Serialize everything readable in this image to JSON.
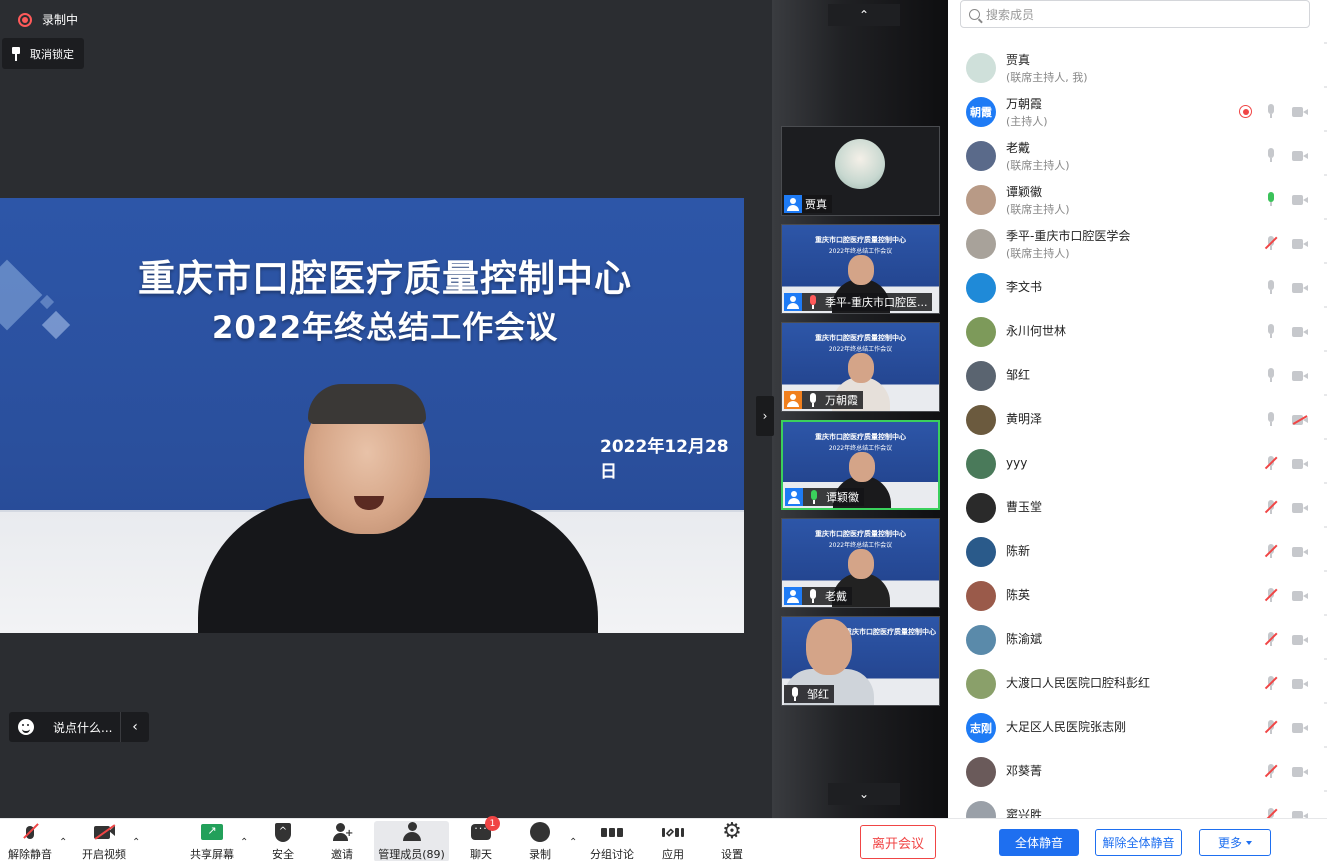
{
  "recording": {
    "label": "录制中",
    "color": "#ff5a5a"
  },
  "pin": {
    "label": "取消锁定"
  },
  "slide": {
    "title": "重庆市口腔医疗质量控制中心",
    "subtitle": "2022年终总结工作会议",
    "date": "2022年12月28日"
  },
  "chat_bar": {
    "placeholder": "说点什么..."
  },
  "gallery": {
    "mini_title": "重庆市口腔医疗质量控制中心",
    "mini_subtitle": "2022年终总结工作会议",
    "tiles": [
      {
        "name": "贾真"
      },
      {
        "name": "季平-重庆市口腔医..."
      },
      {
        "name": "万朝霞"
      },
      {
        "name": "谭颖徽"
      },
      {
        "name": "老戴"
      },
      {
        "name": "邹红"
      }
    ]
  },
  "search": {
    "placeholder": "搜索成员"
  },
  "members": [
    {
      "name": "贾真",
      "role": "(联席主持人, 我)",
      "avatar_color": "#cfe0da"
    },
    {
      "name": "万朝霞",
      "role": "(主持人)",
      "avatar_text": "朝霞",
      "avatar_color": "#1e7bf5"
    },
    {
      "name": "老戴",
      "role": "(联席主持人)",
      "avatar_color": "#5a6a8a"
    },
    {
      "name": "谭颖徽",
      "role": "(联席主持人)",
      "avatar_color": "#b89a86"
    },
    {
      "name": "季平-重庆市口腔医学会",
      "role": "(联席主持人)",
      "avatar_color": "#a8a29a"
    },
    {
      "name": "李文书",
      "role": "",
      "avatar_color": "#1f8ad8"
    },
    {
      "name": "永川何世林",
      "role": "",
      "avatar_color": "#7d9a5a"
    },
    {
      "name": "邹红",
      "role": "",
      "avatar_color": "#5a6470"
    },
    {
      "name": "黄明泽",
      "role": "",
      "avatar_color": "#6b5a3e"
    },
    {
      "name": "yyy",
      "role": "",
      "avatar_color": "#4a7a5a"
    },
    {
      "name": "曹玉堂",
      "role": "",
      "avatar_color": "#2a2a2a"
    },
    {
      "name": "陈新",
      "role": "",
      "avatar_color": "#2a5a8a"
    },
    {
      "name": "陈英",
      "role": "",
      "avatar_color": "#9a5a4a"
    },
    {
      "name": "陈渝斌",
      "role": "",
      "avatar_color": "#5a8aaa"
    },
    {
      "name": "大渡口人民医院口腔科彭红",
      "role": "",
      "avatar_color": "#8aa06a"
    },
    {
      "name": "大足区人民医院张志刚",
      "role": "",
      "avatar_text": "志刚",
      "avatar_color": "#1e7bf5"
    },
    {
      "name": "邓葵菁",
      "role": "",
      "avatar_color": "#6a5a5a"
    },
    {
      "name": "窦兴胜",
      "role": "",
      "avatar_color": "#9aa0a8"
    }
  ],
  "panel_footer": {
    "mute_all": "全体静音",
    "unmute_all": "解除全体静音",
    "more": "更多"
  },
  "toolbar": {
    "unmute": "解除静音",
    "start_video": "开启视频",
    "share": "共享屏幕",
    "security": "安全",
    "invite": "邀请",
    "members": "管理成员(89)",
    "chat": "聊天",
    "chat_badge": "1",
    "record": "录制",
    "breakout": "分组讨论",
    "apps": "应用",
    "settings": "设置",
    "leave": "离开会议"
  },
  "colors": {
    "accent": "#1e6ff0",
    "danger": "#f04545",
    "speaking": "#3ad05c"
  }
}
